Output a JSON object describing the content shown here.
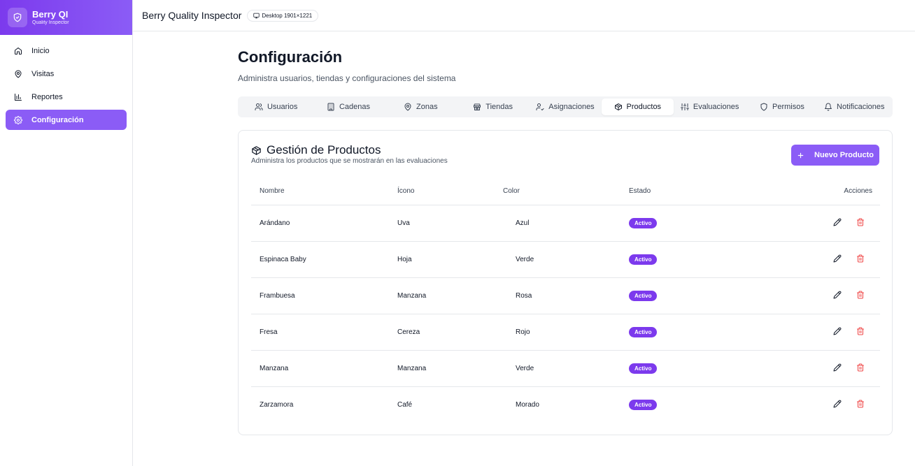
{
  "brand": {
    "title": "Berry QI",
    "subtitle": "Quality Inspector"
  },
  "sidebar": {
    "items": [
      {
        "label": "Inicio",
        "icon": "home-icon"
      },
      {
        "label": "Visitas",
        "icon": "map-pin-icon"
      },
      {
        "label": "Reportes",
        "icon": "bar-chart-icon"
      },
      {
        "label": "Configuración",
        "icon": "gear-icon",
        "active": true
      }
    ]
  },
  "header": {
    "app_name": "Berry Quality Inspector",
    "viewport": "Desktop 1901×1221"
  },
  "page": {
    "title": "Configuración",
    "subtitle": "Administra usuarios, tiendas y configuraciones del sistema"
  },
  "tabs": [
    {
      "label": "Usuarios",
      "icon": "users-icon"
    },
    {
      "label": "Cadenas",
      "icon": "building-icon"
    },
    {
      "label": "Zonas",
      "icon": "map-pin-icon"
    },
    {
      "label": "Tiendas",
      "icon": "store-icon"
    },
    {
      "label": "Asignaciones",
      "icon": "user-check-icon"
    },
    {
      "label": "Productos",
      "icon": "package-icon",
      "active": true
    },
    {
      "label": "Evaluaciones",
      "icon": "sliders-icon"
    },
    {
      "label": "Permisos",
      "icon": "shield-icon"
    },
    {
      "label": "Notificaciones",
      "icon": "bell-icon"
    }
  ],
  "card": {
    "title": "Gestión de Productos",
    "subtitle": "Administra los productos que se mostrarán en las evaluaciones",
    "new_button": "Nuevo Producto"
  },
  "table": {
    "headers": {
      "name": "Nombre",
      "icon": "Ícono",
      "color": "Color",
      "state": "Estado",
      "actions": "Acciones"
    },
    "rows": [
      {
        "name": "Arándano",
        "icon": "Uva",
        "color": "Azul",
        "state": "Activo"
      },
      {
        "name": "Espinaca Baby",
        "icon": "Hoja",
        "color": "Verde",
        "state": "Activo"
      },
      {
        "name": "Frambuesa",
        "icon": "Manzana",
        "color": "Rosa",
        "state": "Activo"
      },
      {
        "name": "Fresa",
        "icon": "Cereza",
        "color": "Rojo",
        "state": "Activo"
      },
      {
        "name": "Manzana",
        "icon": "Manzana",
        "color": "Verde",
        "state": "Activo"
      },
      {
        "name": "Zarzamora",
        "icon": "Café",
        "color": "Morado",
        "state": "Activo"
      }
    ]
  },
  "colors": {
    "accent": "#8b5cf6",
    "badge": "#7c3aed",
    "danger": "#ef4444"
  }
}
